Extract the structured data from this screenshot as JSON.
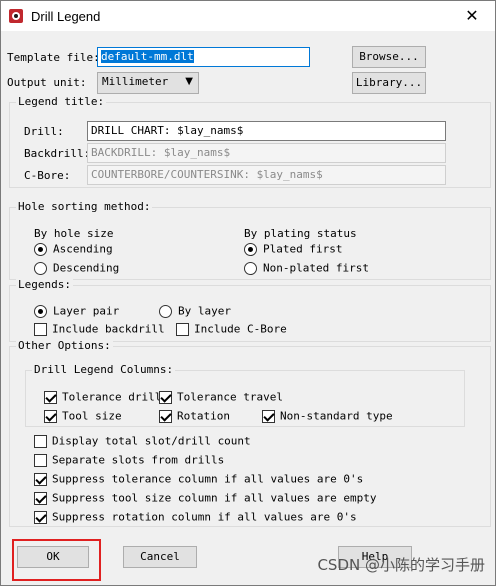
{
  "window": {
    "title": "Drill Legend",
    "close_glyph": "✕"
  },
  "template_file": {
    "label": "Template file:",
    "value": "default-mm.dlt",
    "browse_label": "Browse..."
  },
  "output_unit": {
    "label": "Output unit:",
    "value": "Millimeter",
    "library_label": "Library..."
  },
  "legend_title": {
    "group_label": "Legend title:",
    "drill": {
      "label": "Drill:",
      "value": "DRILL CHART: $lay_nams$"
    },
    "backdrill": {
      "label": "Backdrill:",
      "value": "BACKDRILL: $lay_nams$"
    },
    "cbore": {
      "label": "C-Bore:",
      "value": "COUNTERBORE/COUNTERSINK: $lay_nams$"
    }
  },
  "hole_sorting": {
    "group_label": "Hole sorting method:",
    "by_hole_size": {
      "label": "By hole size",
      "ascending": "Ascending",
      "descending": "Descending"
    },
    "by_plating": {
      "label": "By plating status",
      "plated_first": "Plated first",
      "nonplated_first": "Non-plated first"
    }
  },
  "legends": {
    "group_label": "Legends:",
    "layer_pair": "Layer pair",
    "by_layer": "By layer",
    "include_backdrill": "Include backdrill",
    "include_cbore": "Include C-Bore"
  },
  "other_options": {
    "group_label": "Other Options:",
    "columns_group_label": "Drill Legend Columns:",
    "tolerance_drill": "Tolerance drill",
    "tolerance_travel": "Tolerance travel",
    "tool_size": "Tool size",
    "rotation": "Rotation",
    "nonstandard_type": "Non-standard type",
    "display_total": "Display total slot/drill count",
    "separate_slots": "Separate slots from drills",
    "suppress_tolerance": "Suppress tolerance column if all values are 0's",
    "suppress_tool_size": "Suppress tool size column if all values are empty",
    "suppress_rotation": "Suppress rotation column if all values are 0's"
  },
  "buttons": {
    "ok": "OK",
    "cancel": "Cancel",
    "help": "Help"
  },
  "watermark": "CSDN @小陈的学习手册",
  "colors": {
    "highlight": "#e02020",
    "selection": "#0078d7"
  }
}
